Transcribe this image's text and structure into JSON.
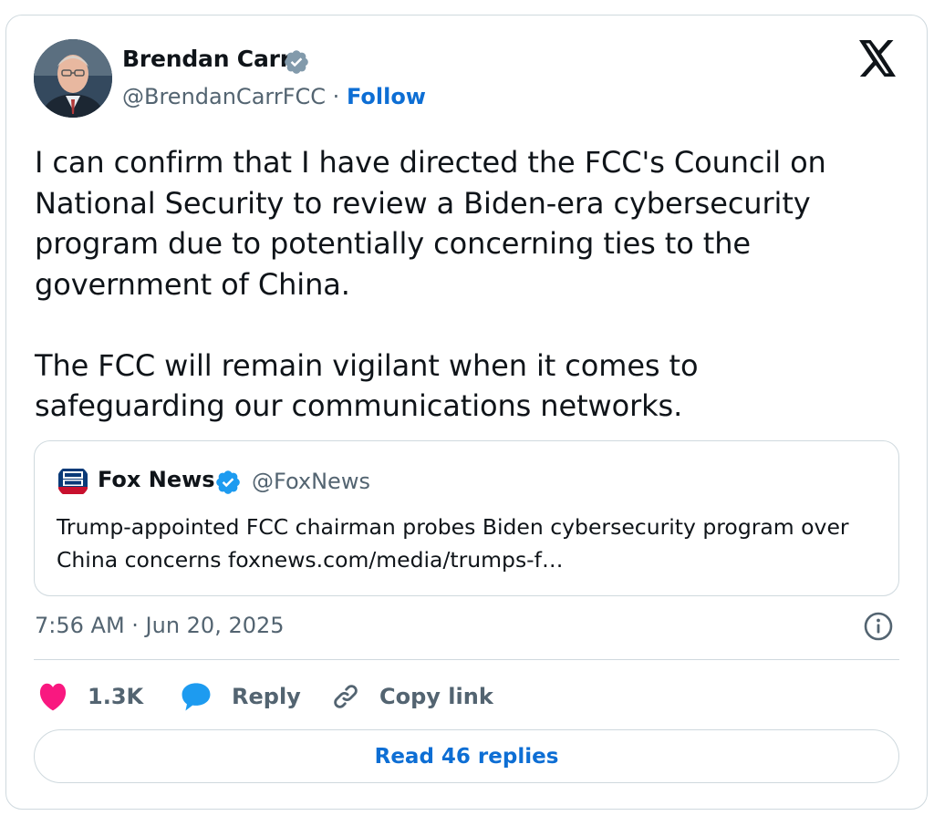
{
  "author": {
    "name": "Brendan Carr",
    "handle": "@BrendanCarrFCC",
    "separator": "·",
    "follow_label": "Follow"
  },
  "tweet": {
    "paragraphs": [
      "I can confirm that I have directed the FCC's Council on National Security to review a Biden-era cybersecurity program due to potentially concerning ties to the government of China.",
      "The FCC will remain vigilant when it comes to safeguarding our communications networks."
    ]
  },
  "quote": {
    "name": "Fox News",
    "handle": "@FoxNews",
    "text": "Trump-appointed FCC chairman probes Biden cybersecurity program over China concerns foxnews.com/media/trumps-f…"
  },
  "meta": {
    "timestamp": "7:56 AM · Jun 20, 2025"
  },
  "actions": {
    "like_count": "1.3K",
    "reply_label": "Reply",
    "copy_label": "Copy link"
  },
  "read_replies_label": "Read 46 replies",
  "colors": {
    "link_blue": "#0d6ed4",
    "verified_blue": "#1d9bf0",
    "verified_gray": "#829aab",
    "like_pink": "#f91880",
    "muted_text": "#536471",
    "border": "#cfd9de"
  },
  "icons": [
    "verified-gray-icon",
    "x-logo-icon",
    "verified-blue-icon",
    "info-icon",
    "heart-icon",
    "reply-bubble-icon",
    "link-icon"
  ]
}
